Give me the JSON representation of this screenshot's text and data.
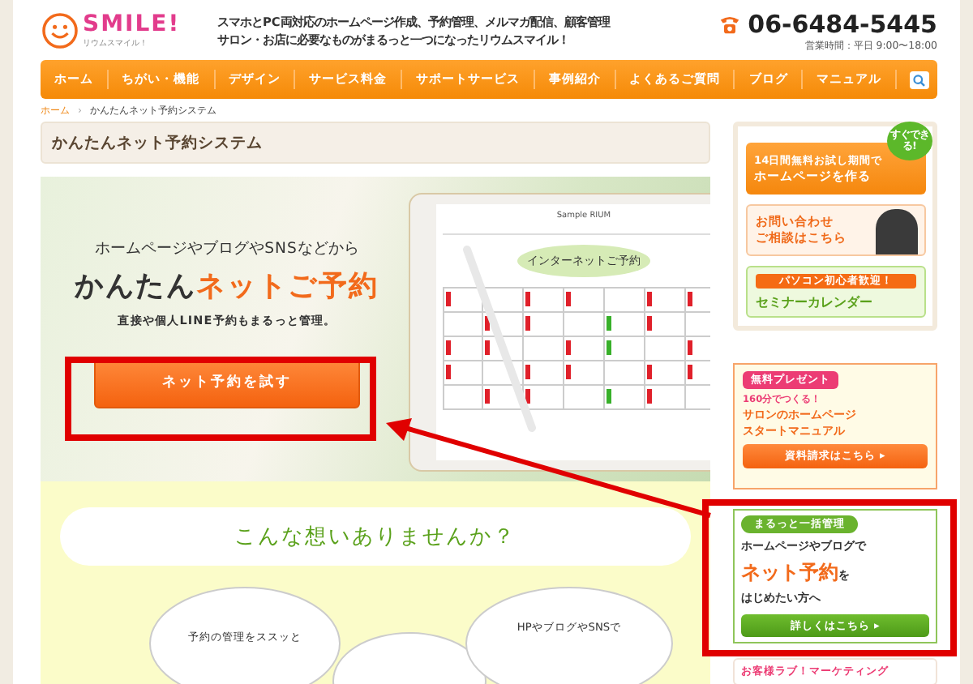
{
  "header": {
    "logo": "SMILE!",
    "logo_sub": "リウムスマイル！",
    "tagline": [
      "スマホとPC両対応のホームページ作成、予約管理、メルマガ配信、顧客管理",
      "サロン・お店に必要なものがまるっと一つになったリウムスマイル！"
    ],
    "phone": "06-6484-5445",
    "hours": "営業時間：平日 9:00〜18:00"
  },
  "nav": [
    "ホーム",
    "ちがい・機能",
    "デザイン",
    "サービス料金",
    "サポートサービス",
    "事例紹介",
    "よくあるご質問",
    "ブログ",
    "マニュアル"
  ],
  "breadcrumb": {
    "home": "ホーム",
    "separator": "›",
    "current": "かんたんネット予約システム"
  },
  "page_title": "かんたんネット予約システム",
  "hero": {
    "lead": "ホームページやブログやSNSなどから",
    "headline": "かんたん**ネットご予約**",
    "sub": "直接や個人LINE予約もまるっと管理。",
    "button": "ネット予約を試す",
    "tablet_title": "Sample RIUM",
    "tablet_heading": "インターネットご予約"
  },
  "section": {
    "heading": "こんな想いありませんか？",
    "clouds": [
      "予約の管理をススッと",
      "HPやブログやSNSで"
    ]
  },
  "sidebar": {
    "trial": {
      "badge": "すぐできる!",
      "line1": "14日間無料お試し期間で",
      "line2": "ホームページを作る"
    },
    "contact": {
      "line1": "お問い合わせ",
      "line2": "ご相談はこちら"
    },
    "seminar": {
      "tag": "パソコン初心者歓迎！",
      "title": "セミナーカレンダー"
    },
    "present": {
      "tag": "無料プレゼント",
      "line1": "160分でつくる！",
      "line2": "サロンのホームページ",
      "line3": "スタートマニュアル",
      "button": "資料請求はこちら ▸"
    },
    "booking": {
      "tag": "まるっと一括管理",
      "line1": "ホームページやブログで",
      "line2": "**ネット予約**を",
      "line3": "はじめたい方へ",
      "button": "詳しくはこちら ▸"
    },
    "marketing": "お客様ラブ！マーケティング"
  }
}
